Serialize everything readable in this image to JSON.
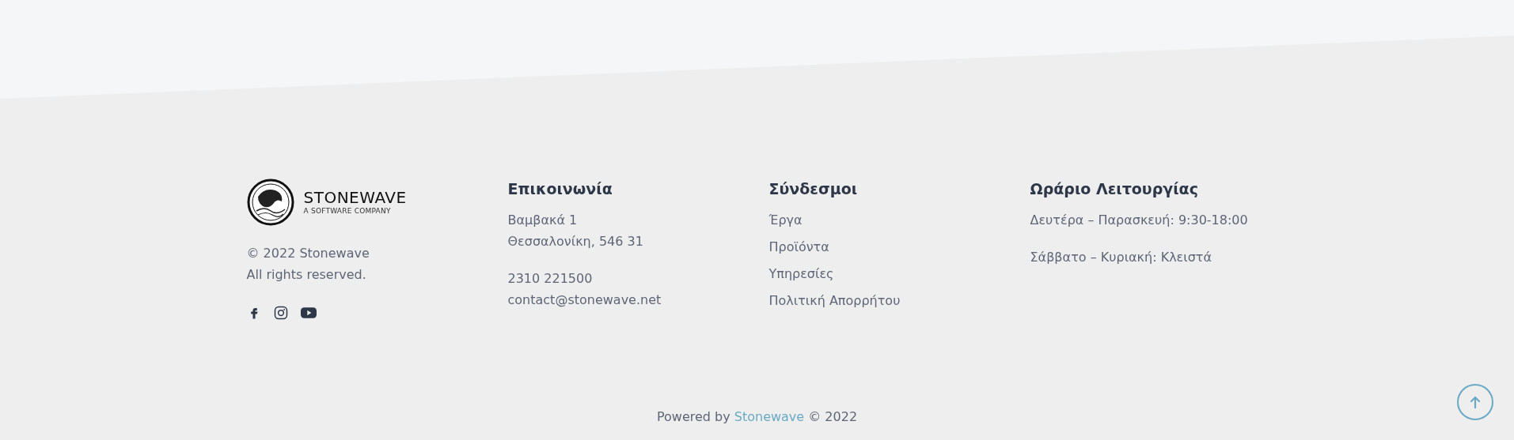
{
  "brand": {
    "name": "STONEWAVE",
    "tagline": "A SOFTWARE COMPANY"
  },
  "copyright": [
    "© 2022 Stonewave",
    "All rights reserved."
  ],
  "contact": {
    "title": "Επικοινωνία",
    "groups": [
      [
        "Βαμβακά 1",
        "Θεσσαλονίκη, 546 31"
      ],
      [
        "2310 221500",
        "contact@stonewave.net"
      ]
    ]
  },
  "links": {
    "title": "Σύνδεσμοι",
    "items": [
      "Έργα",
      "Προϊόντα",
      "Υπηρεσίες",
      "Πολιτική Απορρήτου"
    ]
  },
  "hours": {
    "title": "Ωράριο Λειτουργίας",
    "lines": [
      "Δευτέρα – Παρασκευή: 9:30-18:00",
      "Σάββατο – Κυριακή: Κλειστά"
    ]
  },
  "bottom": {
    "prefix": "Powered by",
    "link": "Stonewave",
    "suffix": "© 2022"
  }
}
